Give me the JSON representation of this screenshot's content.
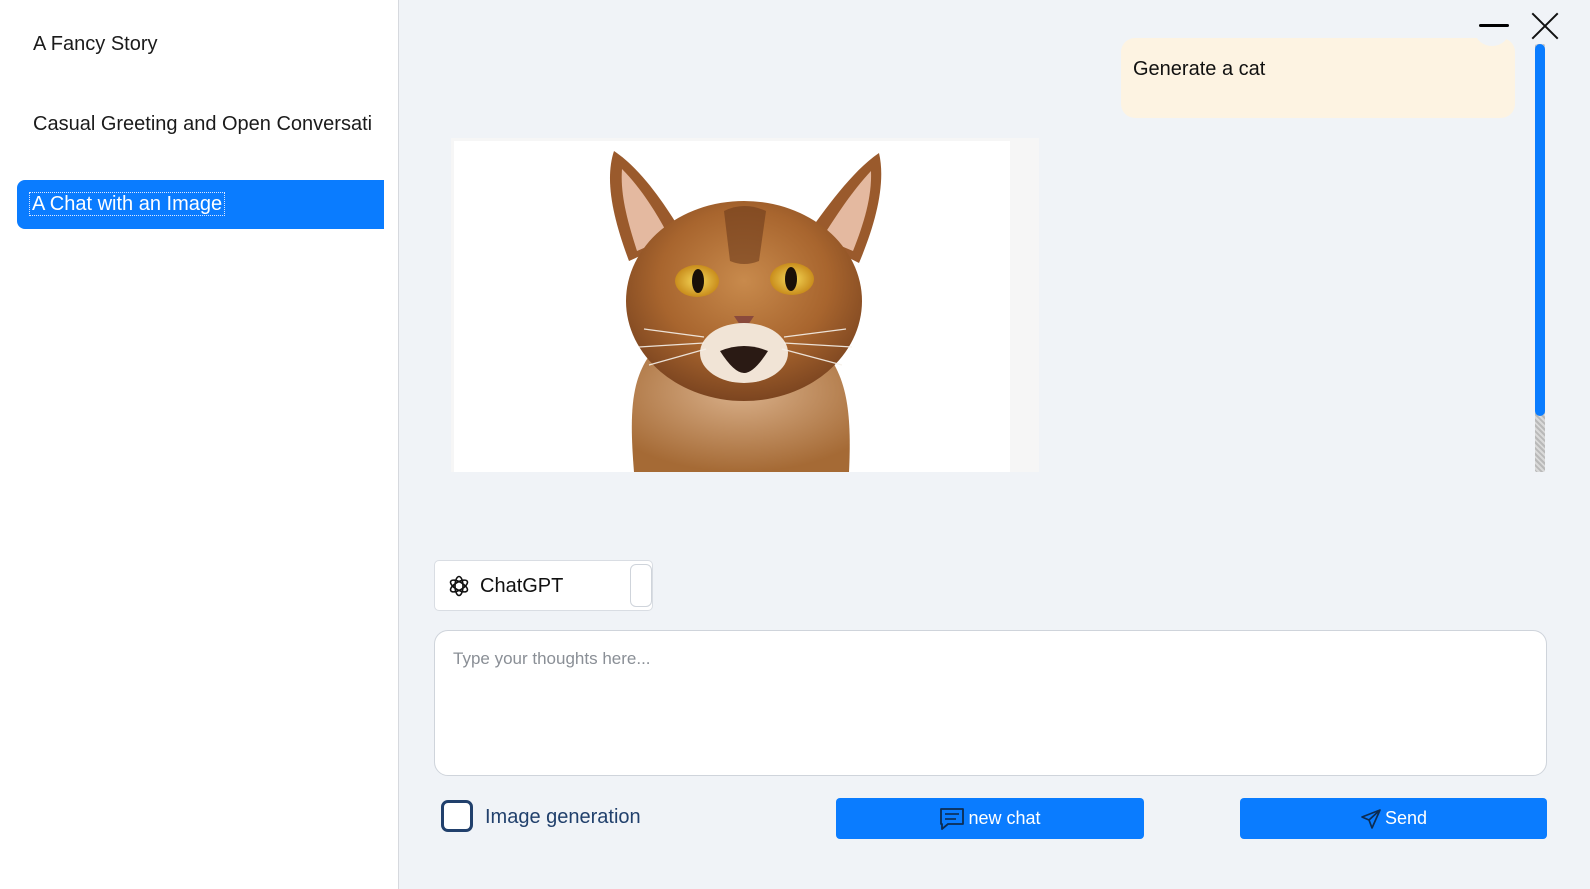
{
  "sidebar": {
    "conversations": [
      {
        "title": "A Fancy Story"
      },
      {
        "title": "Casual Greeting and Open Conversati"
      },
      {
        "title": "A Chat with an Image",
        "active": true
      }
    ]
  },
  "chat": {
    "user_message": "Generate a cat",
    "generated_image": "cat"
  },
  "model_selector": {
    "selected": "ChatGPT",
    "icon": "openai-icon"
  },
  "prompt": {
    "placeholder": "Type your thoughts here...",
    "value": ""
  },
  "options": {
    "image_generation_label": "Image generation",
    "image_generation_checked": false
  },
  "buttons": {
    "new_chat": "new chat",
    "send": "Send"
  },
  "colors": {
    "accent": "#0a7cff",
    "user_bubble": "#fdf3e2",
    "background": "#f0f3f7"
  }
}
